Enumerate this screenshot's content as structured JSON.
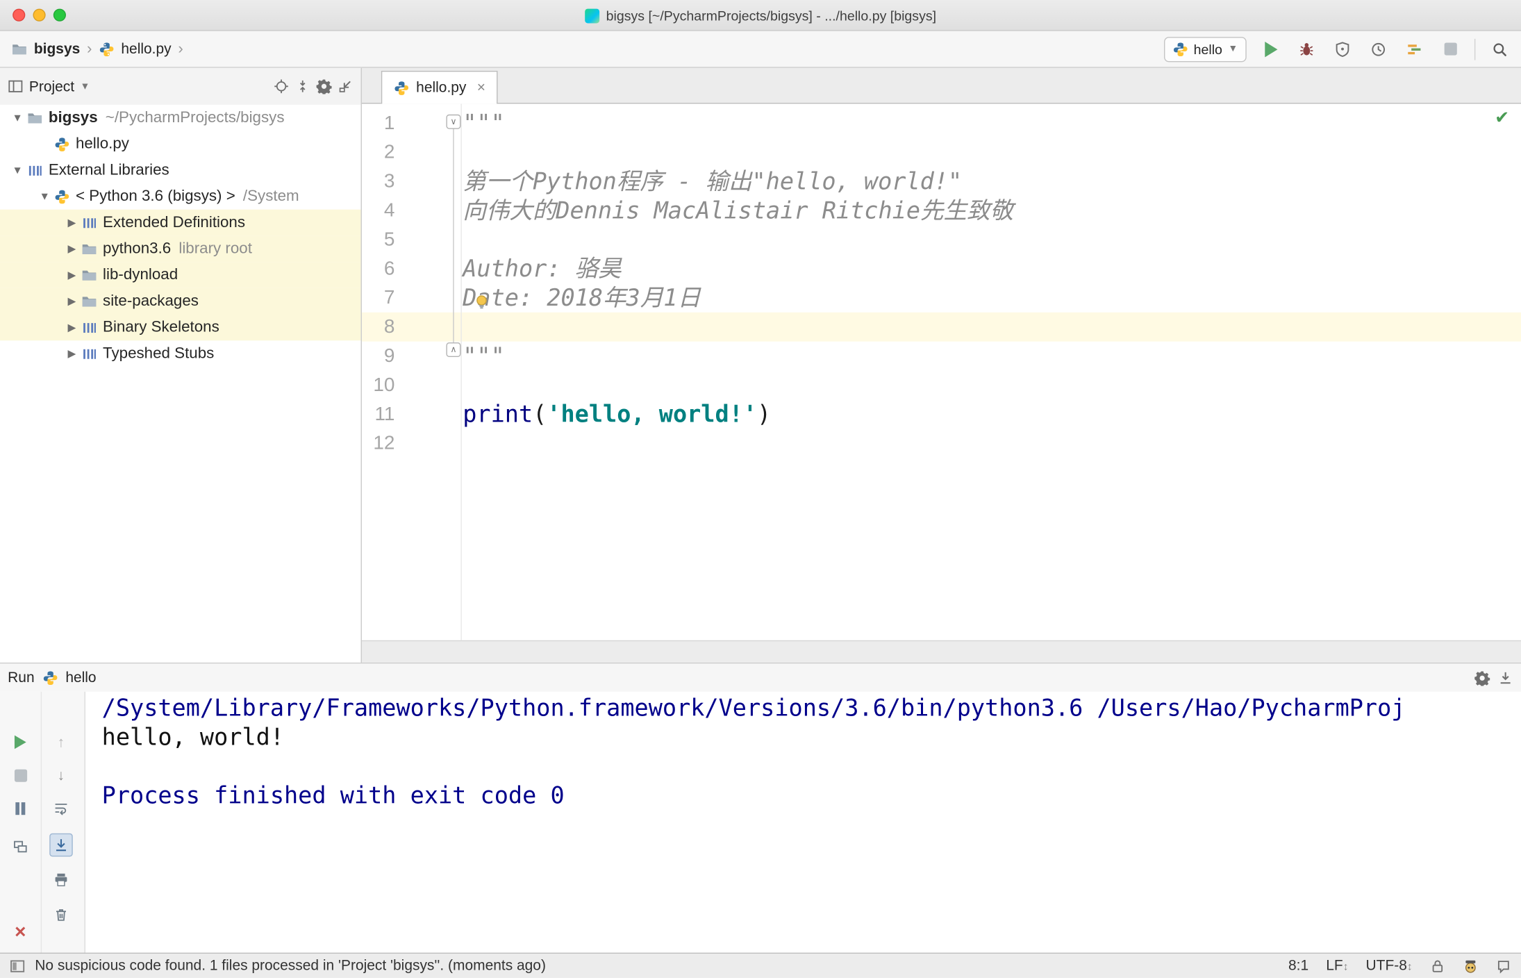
{
  "colors": {
    "accent_green": "#59a869",
    "keyword": "#000080",
    "string": "#008080",
    "docstring": "#8c8c8c",
    "console_system": "#00008b",
    "current_line_highlight": "#fffae3",
    "tree_highlight": "#fcf8da"
  },
  "titlebar": {
    "title": "bigsys [~/PycharmProjects/bigsys] - .../hello.py [bigsys]"
  },
  "navbar": {
    "crumb1": "bigsys",
    "crumb2": "hello.py",
    "run_config": "hello"
  },
  "project": {
    "header": "Project",
    "rows": [
      {
        "label": "bigsys",
        "suffix": "~/PycharmProjects/bigsys"
      },
      {
        "label": "hello.py"
      },
      {
        "label": "External Libraries"
      },
      {
        "label": "< Python 3.6 (bigsys) >",
        "suffix": "/System"
      },
      {
        "label": "Extended Definitions"
      },
      {
        "label": "python3.6",
        "suffix": "library root"
      },
      {
        "label": "lib-dynload"
      },
      {
        "label": "site-packages"
      },
      {
        "label": "Binary Skeletons"
      },
      {
        "label": "Typeshed Stubs"
      }
    ]
  },
  "editor": {
    "tab": "hello.py",
    "line_numbers": [
      "1",
      "2",
      "3",
      "4",
      "5",
      "6",
      "7",
      "8",
      "9",
      "10",
      "11",
      "12"
    ],
    "code": {
      "l1": "\"\"\"",
      "l3": "第一个Python程序 - 输出\"hello, world!\"",
      "l4": "向伟大的Dennis MacAlistair Ritchie先生致敬",
      "l6": "Author: 骆昊",
      "l7": "Date: 2018年3月1日",
      "l9": "\"\"\"",
      "l11_kw": "print",
      "l11_p1": "(",
      "l11_str": "'hello, world!'",
      "l11_p2": ")"
    }
  },
  "run": {
    "title": "Run",
    "config": "hello",
    "console": {
      "line1": "/System/Library/Frameworks/Python.framework/Versions/3.6/bin/python3.6 /Users/Hao/PycharmProj",
      "line2": "hello, world!",
      "line4": "Process finished with exit code 0"
    }
  },
  "statusbar": {
    "message": "No suspicious code found. 1 files processed in 'Project 'bigsys''. (moments ago)",
    "caret": "8:1",
    "line_sep": "LF",
    "encoding": "UTF-8"
  }
}
